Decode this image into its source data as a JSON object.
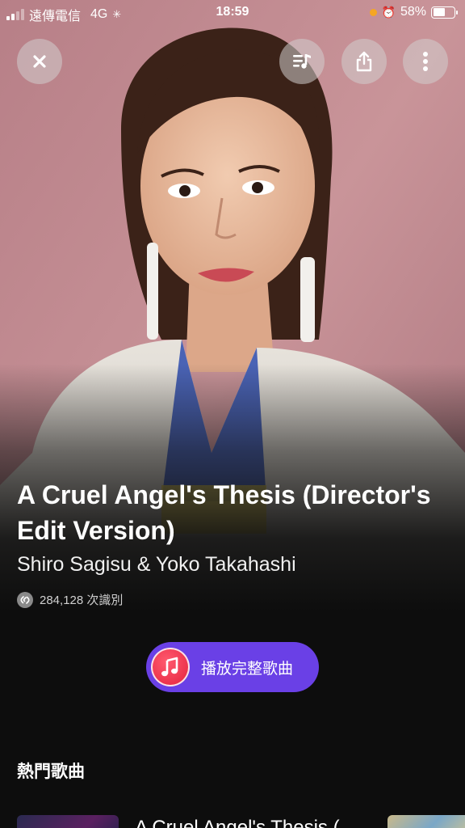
{
  "status_bar": {
    "carrier": "遠傳電信",
    "network": "4G",
    "time": "18:59",
    "battery": "58%"
  },
  "top_buttons": {
    "close_icon": "close-icon",
    "queue_icon": "music-queue-icon",
    "share_icon": "share-icon",
    "more_icon": "more-vertical-icon"
  },
  "song": {
    "title": "A Cruel Angel's Thesis (Director's Edit Version)",
    "artist": "Shiro Sagisu & Yoko Takahashi",
    "shazam_count": "284,128 次識別"
  },
  "play_full_button": {
    "label": "播放完整歌曲",
    "icon": "apple-music-icon"
  },
  "top_songs": {
    "title": "熱門歌曲",
    "items": [
      {
        "title": "A Cruel Angel's Thesis ("
      }
    ]
  },
  "colors": {
    "accent": "#6a40e6",
    "music_app": "#e5233f",
    "background": "#0d0d0d"
  }
}
